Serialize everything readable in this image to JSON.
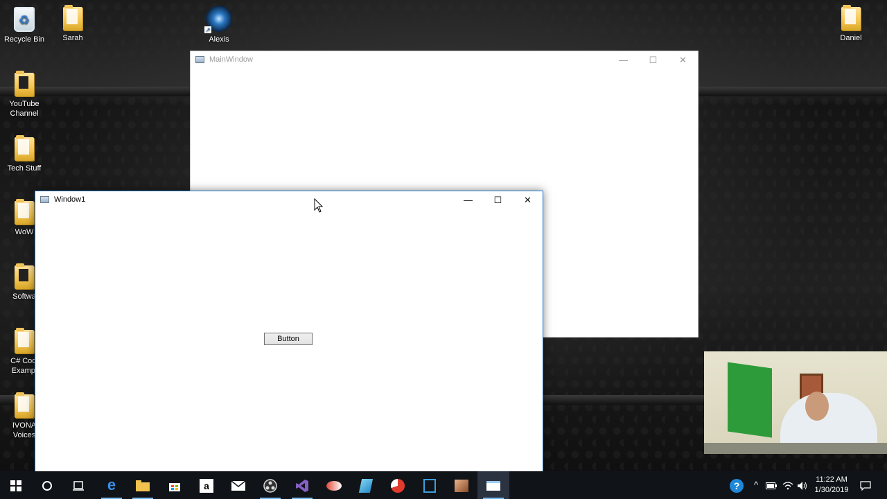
{
  "desktop": {
    "icons": [
      {
        "label": "Recycle Bin"
      },
      {
        "label": "Sarah"
      },
      {
        "label": "Alexis"
      },
      {
        "label": "Daniel"
      },
      {
        "label": "YouTube Channel"
      },
      {
        "label": "Tech Stuff"
      },
      {
        "label": "WoW"
      },
      {
        "label": "Softwa"
      },
      {
        "label": "C# Codi Exampl"
      },
      {
        "label": "IVONA Voices"
      }
    ]
  },
  "main_window": {
    "title": "MainWindow",
    "controls": {
      "minimize": "—",
      "maximize": "☐",
      "close": "✕"
    }
  },
  "window1": {
    "title": "Window1",
    "controls": {
      "minimize": "—",
      "maximize": "☐",
      "close": "✕"
    },
    "button_label": "Button"
  },
  "taskbar": {
    "start_icon": "windows-logo-icon",
    "items": [
      {
        "name": "cortana-search-icon"
      },
      {
        "name": "task-view-icon"
      },
      {
        "name": "edge-icon"
      },
      {
        "name": "file-explorer-icon"
      },
      {
        "name": "store-icon"
      },
      {
        "name": "amazon-icon"
      },
      {
        "name": "mail-icon"
      },
      {
        "name": "obs-icon"
      },
      {
        "name": "visual-studio-icon"
      },
      {
        "name": "app-icon-1"
      },
      {
        "name": "app-icon-2"
      },
      {
        "name": "app-icon-3"
      },
      {
        "name": "app-icon-4"
      },
      {
        "name": "app-icon-5"
      },
      {
        "name": "wpf-app-icon"
      }
    ],
    "clock": {
      "time": "11:22 AM",
      "date": "1/30/2019"
    }
  },
  "colors": {
    "accent": "#1f74c6",
    "taskbar": "#101418"
  }
}
